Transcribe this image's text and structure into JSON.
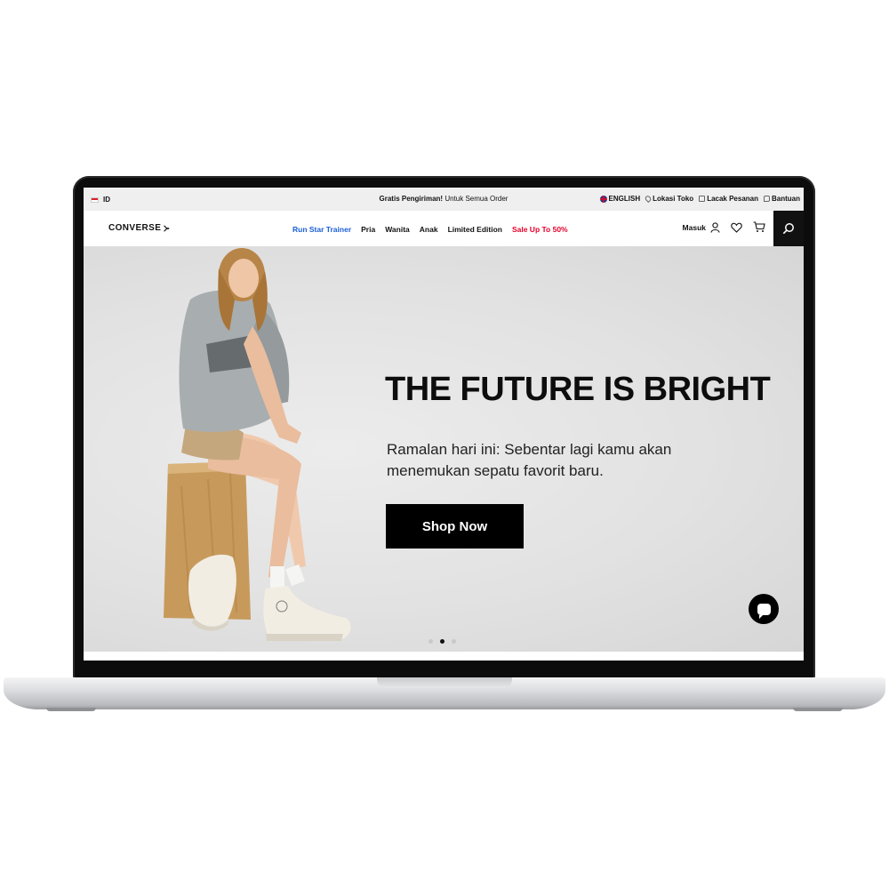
{
  "utility_bar": {
    "locale": "ID",
    "promo_bold": "Gratis Pengiriman!",
    "promo_text": " Untuk Semua Order",
    "links": [
      {
        "label": "ENGLISH",
        "icon": "uk-flag-icon"
      },
      {
        "label": "Lokasi Toko",
        "icon": "location-pin-icon"
      },
      {
        "label": "Lacak Pesanan",
        "icon": "truck-icon"
      },
      {
        "label": "Bantuan",
        "icon": "chat-icon"
      }
    ]
  },
  "header": {
    "logo": "CONVERSE",
    "nav": [
      {
        "label": "Run Star Trainer",
        "style": "featured"
      },
      {
        "label": "Pria",
        "style": "normal"
      },
      {
        "label": "Wanita",
        "style": "normal"
      },
      {
        "label": "Anak",
        "style": "normal"
      },
      {
        "label": "Limited Edition",
        "style": "normal"
      },
      {
        "label": "Sale Up To 50%",
        "style": "sale"
      }
    ],
    "login_label": "Masuk",
    "icons": [
      "user-icon",
      "heart-icon",
      "cart-icon",
      "search-icon"
    ]
  },
  "hero": {
    "title": "THE FUTURE IS BRIGHT",
    "subtitle": "Ramalan hari ini: Sebentar lagi kamu akan menemukan sepatu favorit baru.",
    "cta_label": "Shop Now",
    "carousel_total": 3,
    "carousel_active": 2
  },
  "colors": {
    "featured_nav": "#1a5fd8",
    "sale_nav": "#e4002b",
    "cta_bg": "#000000",
    "hero_bg": "#e2e2e2"
  }
}
